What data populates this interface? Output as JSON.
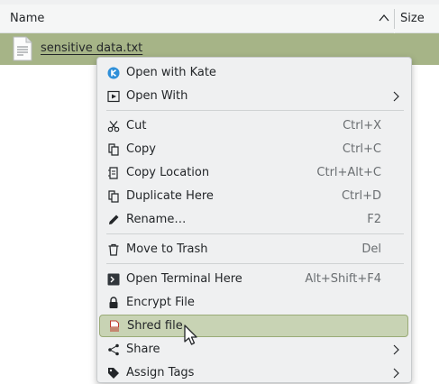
{
  "file_view": {
    "columns": {
      "name": "Name",
      "size": "Size"
    },
    "selected_file": {
      "name": "sensitive data.txt",
      "icon": "text-file-icon"
    }
  },
  "context_menu": {
    "items": {
      "open_with_kate": {
        "label": "Open with Kate",
        "icon": "kate-icon"
      },
      "open_with": {
        "label": "Open With",
        "icon": "open-with-icon"
      },
      "cut": {
        "label": "Cut",
        "shortcut": "Ctrl+X",
        "icon": "scissors-icon"
      },
      "copy": {
        "label": "Copy",
        "shortcut": "Ctrl+C",
        "icon": "copy-icon"
      },
      "copy_location": {
        "label": "Copy Location",
        "shortcut": "Ctrl+Alt+C",
        "icon": "copy-location-icon"
      },
      "duplicate_here": {
        "label": "Duplicate Here",
        "shortcut": "Ctrl+D",
        "icon": "duplicate-icon"
      },
      "rename": {
        "label": "Rename…",
        "shortcut": "F2",
        "icon": "pencil-icon"
      },
      "move_to_trash": {
        "label": "Move to Trash",
        "shortcut": "Del",
        "icon": "trash-icon"
      },
      "open_terminal_here": {
        "label": "Open Terminal Here",
        "shortcut": "Alt+Shift+F4",
        "icon": "terminal-icon"
      },
      "encrypt_file": {
        "label": "Encrypt File",
        "icon": "lock-icon"
      },
      "shred_file": {
        "label": "Shred file",
        "icon": "shred-icon"
      },
      "share": {
        "label": "Share",
        "icon": "share-icon"
      },
      "assign_tags": {
        "label": "Assign Tags",
        "icon": "tag-icon"
      }
    },
    "highlighted_item": "shred_file"
  },
  "colors": {
    "selection": "#a6b487",
    "menu_bg": "#eff0f1",
    "menu_highlight": "#c8d3b4",
    "menu_highlight_border": "#9aab77",
    "kate_blue": "#2e8fd9",
    "shred_red": "#c0392b"
  }
}
